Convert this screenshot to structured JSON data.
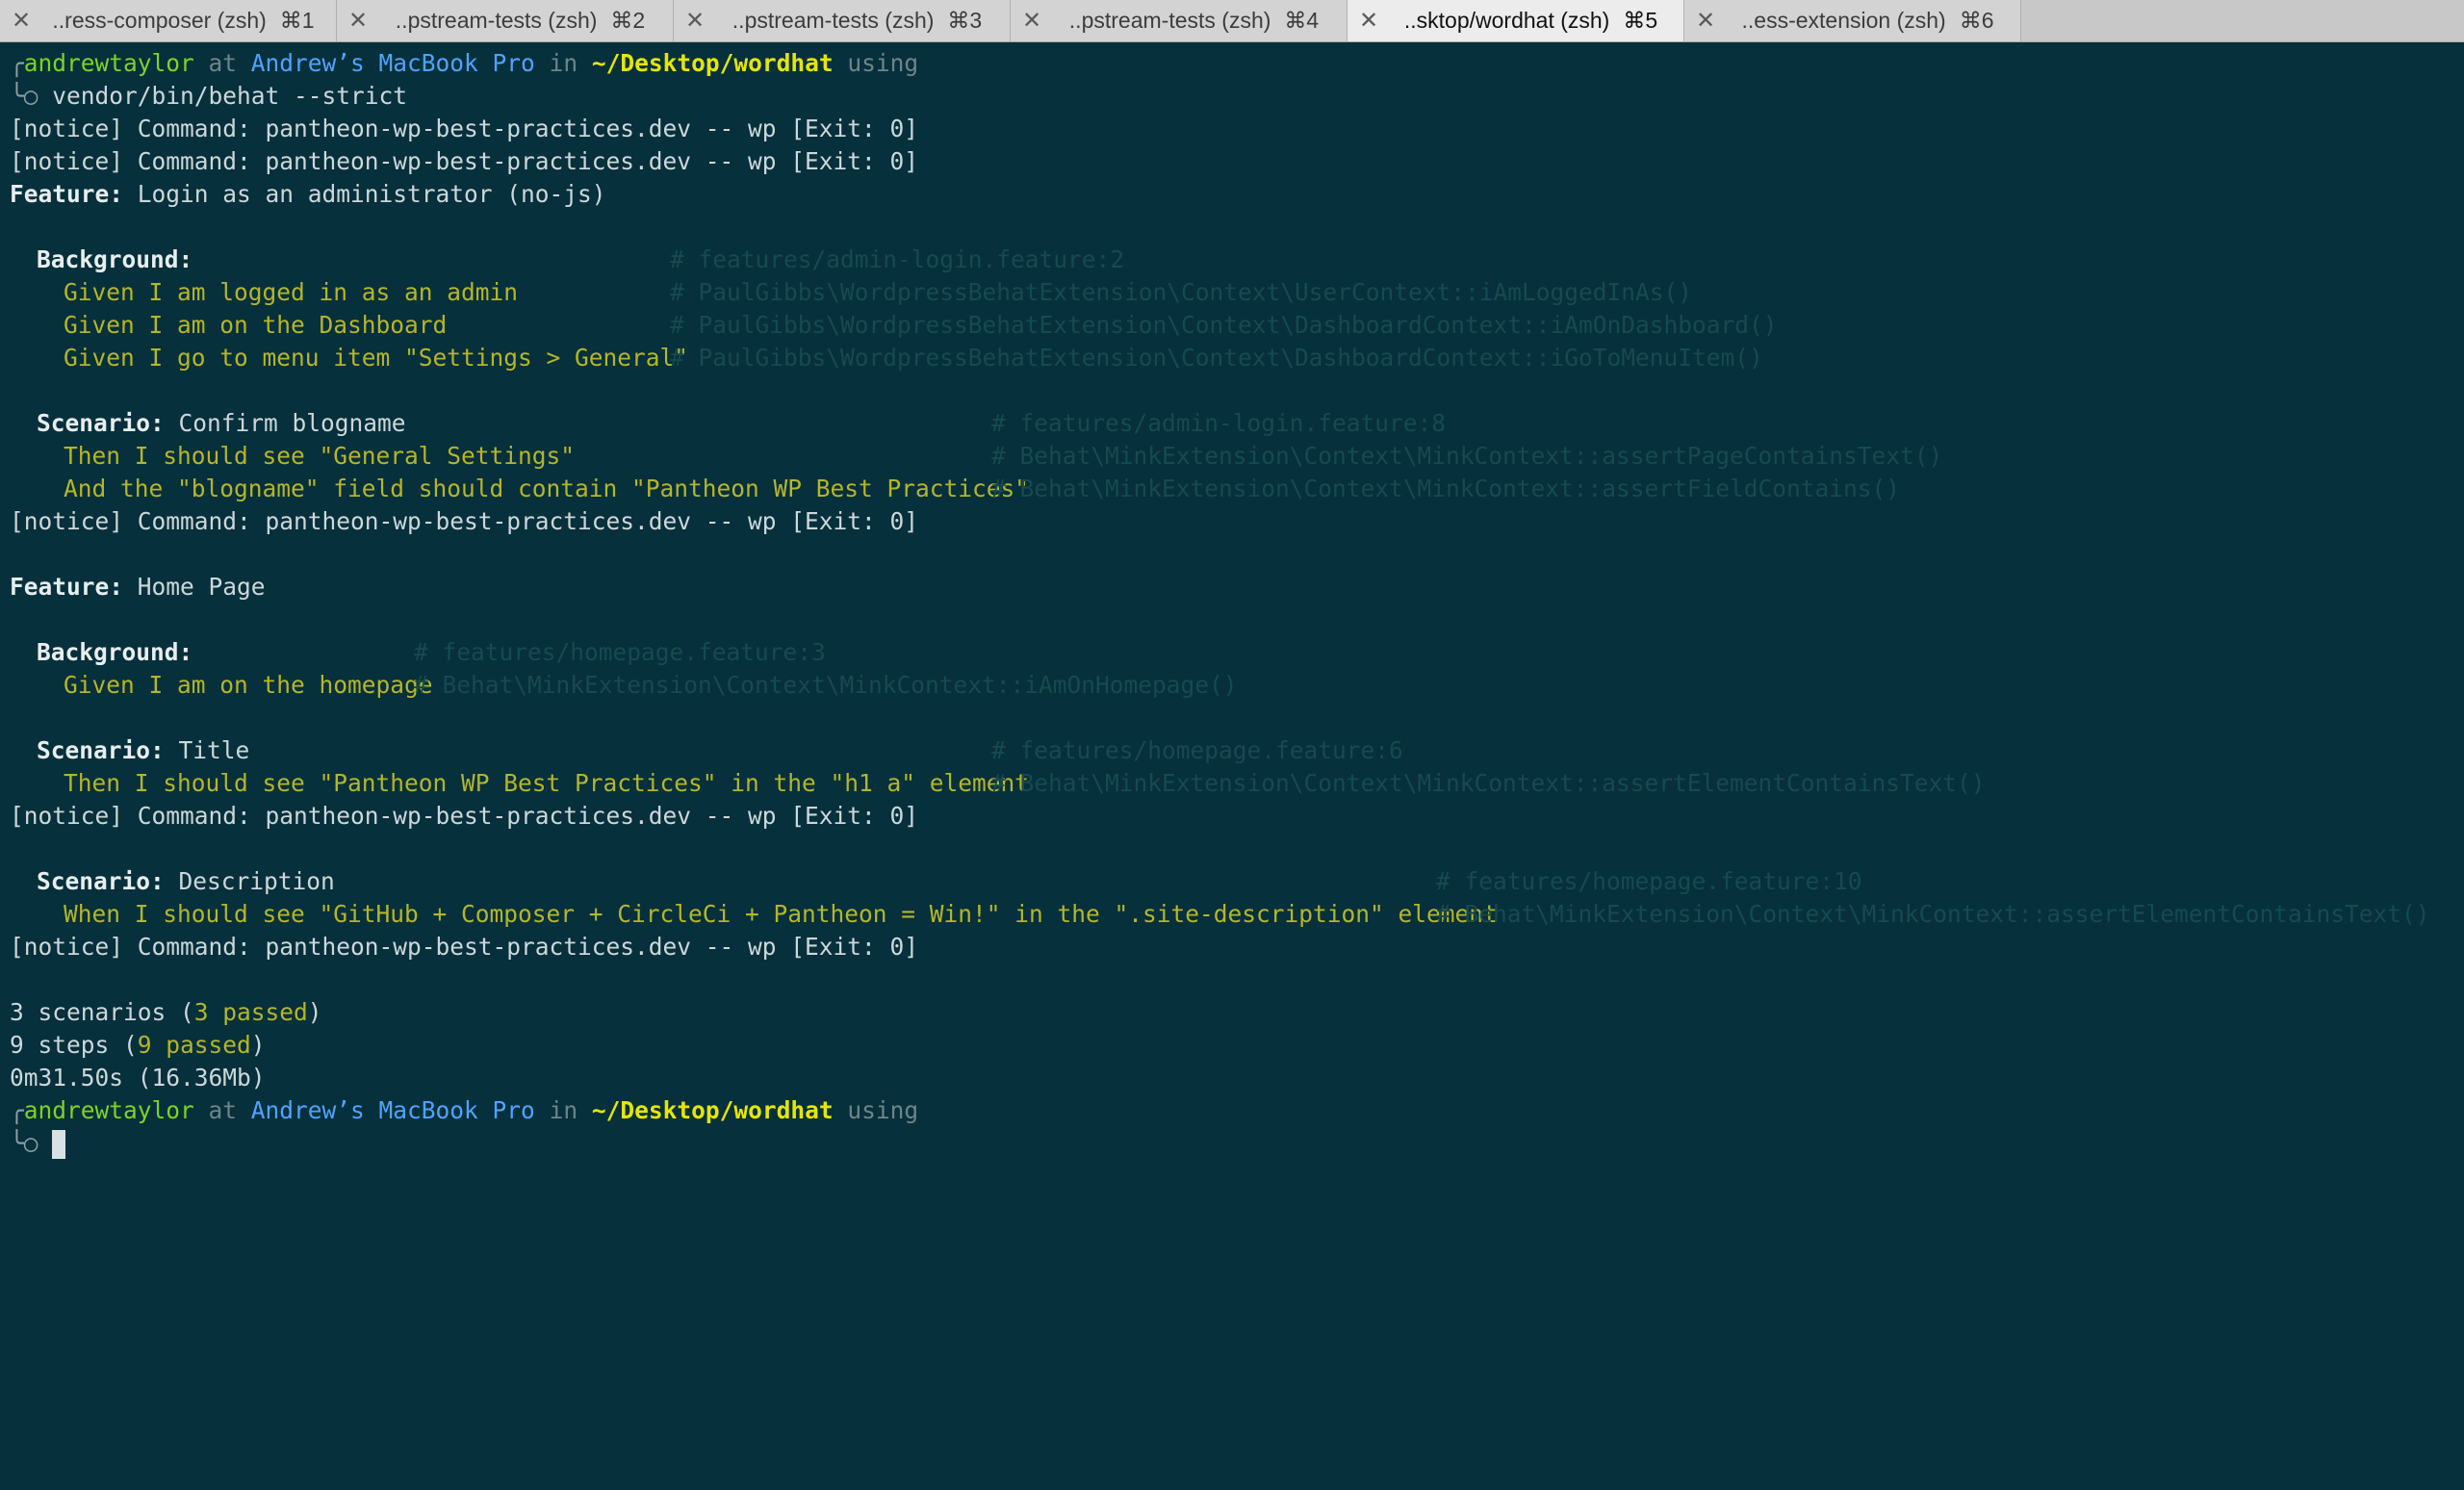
{
  "tabs": [
    {
      "label": "..ress-composer (zsh)",
      "shortcut": "⌘1",
      "active": false
    },
    {
      "label": "..pstream-tests (zsh)",
      "shortcut": "⌘2",
      "active": false
    },
    {
      "label": "..pstream-tests (zsh)",
      "shortcut": "⌘3",
      "active": false
    },
    {
      "label": "..pstream-tests (zsh)",
      "shortcut": "⌘4",
      "active": false
    },
    {
      "label": "..sktop/wordhat (zsh)",
      "shortcut": "⌘5",
      "active": true
    },
    {
      "label": "..ess-extension (zsh)",
      "shortcut": "⌘6",
      "active": false
    }
  ],
  "prompt1": {
    "corner": "╭",
    "user": "andrewtaylor",
    "at": " at ",
    "host": "Andrew’s MacBook Pro",
    "in": " in ",
    "path": "~/Desktop/wordhat",
    "using": " using",
    "tail": "╰○ ",
    "command": "vendor/bin/behat --strict"
  },
  "lines": {
    "notice1": "[notice] Command: pantheon-wp-best-practices.dev -- wp [Exit: 0]",
    "notice2": "[notice] Command: pantheon-wp-best-practices.dev -- wp [Exit: 0]",
    "feature1_kw": "Feature:",
    "feature1_name": " Login as an administrator (no-js)",
    "bg1_kw": "Background:",
    "bg1_step1": "Given I am logged in as an admin",
    "bg1_step2": "Given I am on the Dashboard",
    "bg1_step3": "Given I go to menu item \"Settings > General\"",
    "sc1_kw": "Scenario:",
    "sc1_name": " Confirm blogname",
    "sc1_step1": "Then I should see \"General Settings\"",
    "sc1_step2": "And the \"blogname\" field should contain \"Pantheon WP Best Practices\"",
    "notice3": "[notice] Command: pantheon-wp-best-practices.dev -- wp [Exit: 0]",
    "feature2_kw": "Feature:",
    "feature2_name": " Home Page",
    "bg2_kw": "Background:",
    "bg2_step1": "Given I am on the homepage",
    "sc2_kw": "Scenario:",
    "sc2_name": " Title",
    "sc2_step1": "Then I should see \"Pantheon WP Best Practices\" in the \"h1 a\" element",
    "notice4": "[notice] Command: pantheon-wp-best-practices.dev -- wp [Exit: 0]",
    "sc3_kw": "Scenario:",
    "sc3_name": " Description",
    "sc3_step1": "When I should see \"GitHub + Composer + CircleCi + Pantheon = Win!\" in the \".site-description\" element",
    "notice5": "[notice] Command: pantheon-wp-best-practices.dev -- wp [Exit: 0]",
    "summary_scen_a": "3 scenarios (",
    "summary_scen_b": "3 passed",
    "summary_scen_c": ")",
    "summary_steps_a": "9 steps (",
    "summary_steps_b": "9 passed",
    "summary_steps_c": ")",
    "summary_time": "0m31.50s (16.36Mb)"
  },
  "comments": {
    "f1": "# features/admin-login.feature:2",
    "f1_s1": "# PaulGibbs\\WordpressBehatExtension\\Context\\UserContext::iAmLoggedInAs()",
    "f1_s2": "# PaulGibbs\\WordpressBehatExtension\\Context\\DashboardContext::iAmOnDashboard()",
    "f1_s3": "# PaulGibbs\\WordpressBehatExtension\\Context\\DashboardContext::iGoToMenuItem()",
    "sc1": "# features/admin-login.feature:8",
    "sc1_s1": "# Behat\\MinkExtension\\Context\\MinkContext::assertPageContainsText()",
    "sc1_s2": "# Behat\\MinkExtension\\Context\\MinkContext::assertFieldContains()",
    "f2": "# features/homepage.feature:3",
    "f2_s1": "# Behat\\MinkExtension\\Context\\MinkContext::iAmOnHomepage()",
    "sc2": "# features/homepage.feature:6",
    "sc2_s1": "# Behat\\MinkExtension\\Context\\MinkContext::assertElementContainsText()",
    "sc3": "# features/homepage.feature:10",
    "sc3_s1": "# Behat\\MinkExtension\\Context\\MinkContext::assertElementContainsText()"
  },
  "prompt2": {
    "corner": "╭",
    "user": "andrewtaylor",
    "at": " at ",
    "host": "Andrew’s MacBook Pro",
    "in": " in ",
    "path": "~/Desktop/wordhat",
    "using": " using",
    "tail": "╰○ "
  }
}
